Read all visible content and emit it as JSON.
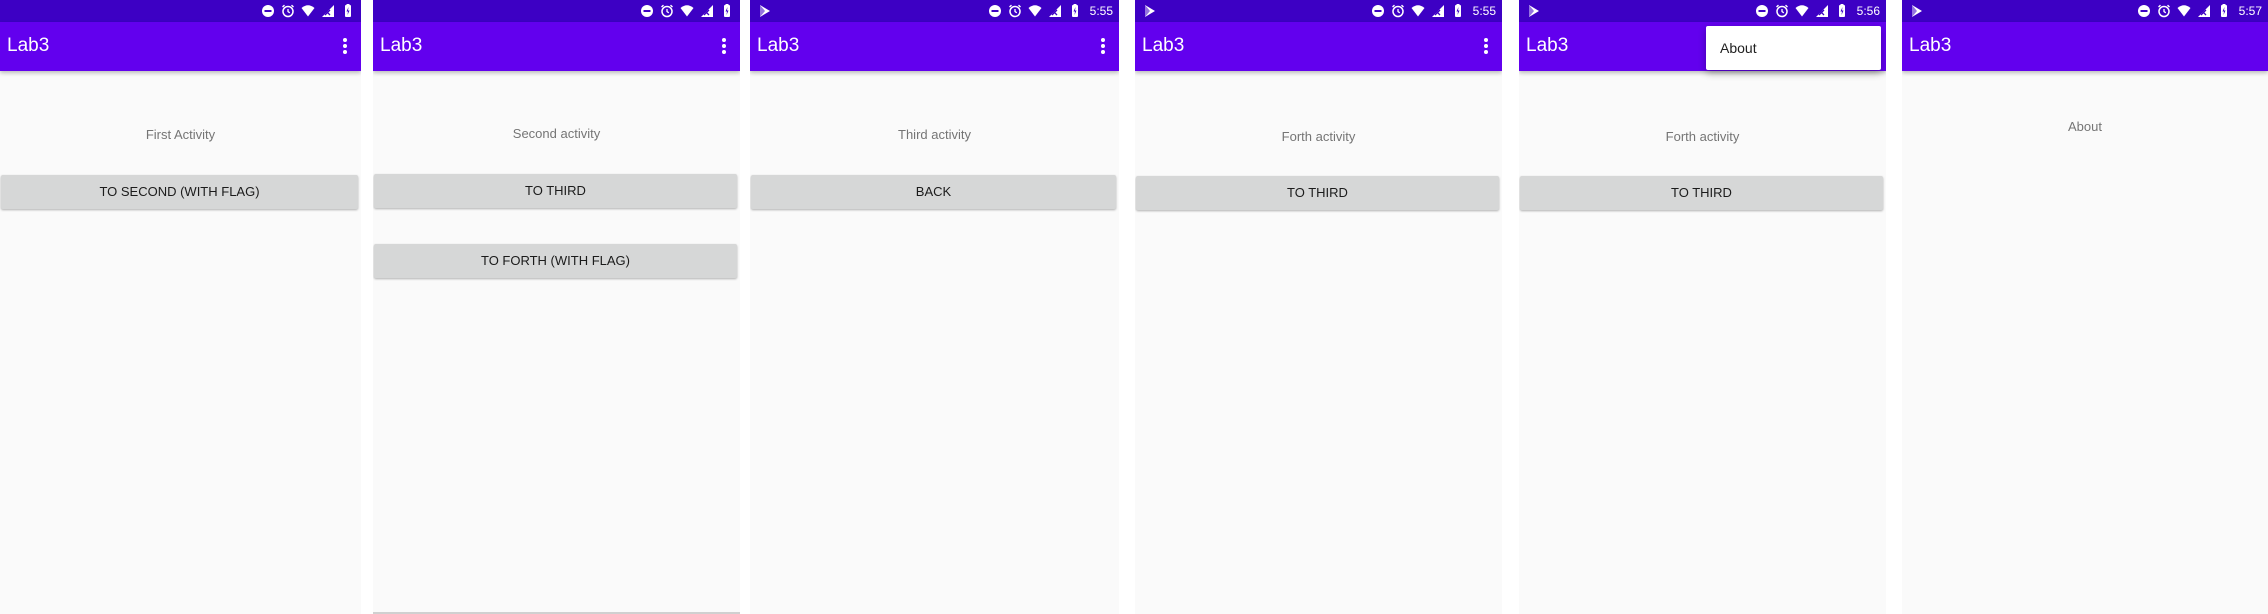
{
  "colors": {
    "status_bar": "#3d00c4",
    "app_bar": "#6200ee",
    "background": "#fafafa",
    "button": "#d6d7d7",
    "label_text": "#757575"
  },
  "screens": [
    {
      "app_title": "Lab3",
      "clock": "",
      "show_play_icon": false,
      "label": "First Activity",
      "buttons": [
        "TO SECOND (WITH FLAG)"
      ]
    },
    {
      "app_title": "Lab3",
      "clock": "",
      "show_play_icon": false,
      "label": "Second activity",
      "buttons": [
        "TO THIRD",
        "TO FORTH (WITH FLAG)"
      ]
    },
    {
      "app_title": "Lab3",
      "clock": "5:55",
      "show_play_icon": true,
      "label": "Third activity",
      "buttons": [
        "BACK"
      ]
    },
    {
      "app_title": "Lab3",
      "clock": "5:55",
      "show_play_icon": true,
      "label": "Forth activity",
      "buttons": [
        "TO THIRD"
      ]
    },
    {
      "app_title": "Lab3",
      "clock": "5:56",
      "show_play_icon": true,
      "label": "Forth activity",
      "buttons": [
        "TO THIRD"
      ],
      "menu_open": true,
      "menu_items": [
        "About"
      ]
    },
    {
      "app_title": "Lab3",
      "clock": "5:57",
      "show_play_icon": true,
      "label": "About",
      "buttons": []
    }
  ],
  "status_icons": [
    "do-not-disturb-icon",
    "alarm-icon",
    "wifi-icon",
    "signal-icon",
    "battery-icon"
  ]
}
